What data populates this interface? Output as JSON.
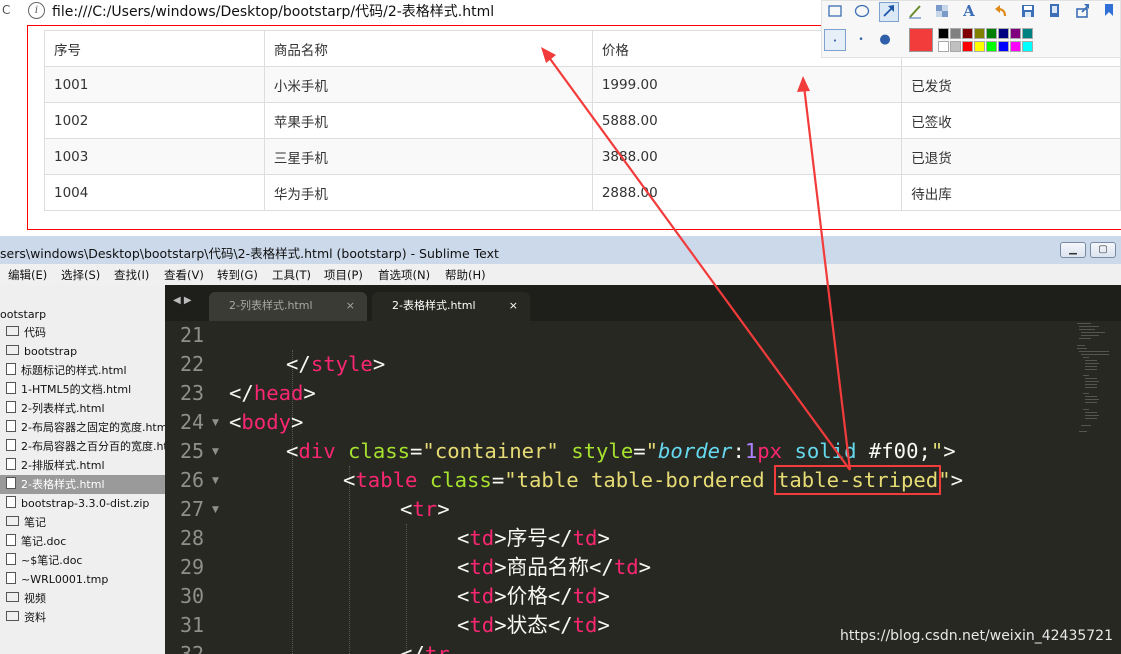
{
  "browser": {
    "url": "file:///C:/Users/windows/Desktop/bootstarp/代码/2-表格样式.html"
  },
  "table": {
    "rows": [
      [
        "序号",
        "商品名称",
        "价格",
        ""
      ],
      [
        "1001",
        "小米手机",
        "1999.00",
        "已发货"
      ],
      [
        "1002",
        "苹果手机",
        "5888.00",
        "已签收"
      ],
      [
        "1003",
        "三星手机",
        "3888.00",
        "已退货"
      ],
      [
        "1004",
        "华为手机",
        "2888.00",
        "待出库"
      ]
    ]
  },
  "annotation_toolbar": {
    "text_tool": "A",
    "current_color": "#f23b3b",
    "palette": [
      "#000000",
      "#808080",
      "#800000",
      "#808000",
      "#008000",
      "#000080",
      "#800080",
      "#008080",
      "#ffffff",
      "#c0c0c0",
      "#ff0000",
      "#ffff00",
      "#00ff00",
      "#0000ff",
      "#ff00ff",
      "#00ffff"
    ],
    "dot_sizes": [
      "•",
      "•",
      "●"
    ]
  },
  "sublime": {
    "title": "sers\\windows\\Desktop\\bootstarp\\代码\\2-表格样式.html (bootstarp) - Sublime Text",
    "menu": [
      "编辑(E)",
      "选择(S)",
      "查找(I)",
      "查看(V)",
      "转到(G)",
      "工具(T)",
      "项目(P)",
      "首选项(N)",
      "帮助(H)"
    ],
    "sidebar": [
      {
        "label": "ootstarp",
        "kind": "root",
        "active": false
      },
      {
        "label": "代码",
        "kind": "folder",
        "active": false
      },
      {
        "label": "bootstrap",
        "kind": "folder",
        "active": false
      },
      {
        "label": "标题标记的样式.html",
        "kind": "file",
        "active": false
      },
      {
        "label": "1-HTML5的文档.html",
        "kind": "file",
        "active": false
      },
      {
        "label": "2-列表样式.html",
        "kind": "file",
        "active": false
      },
      {
        "label": "2-布局容器之固定的宽度.html",
        "kind": "file",
        "active": false
      },
      {
        "label": "2-布局容器之百分百的宽度.html",
        "kind": "file",
        "active": false
      },
      {
        "label": "2-排版样式.html",
        "kind": "file",
        "active": false
      },
      {
        "label": "2-表格样式.html",
        "kind": "file",
        "active": true
      },
      {
        "label": "bootstrap-3.3.0-dist.zip",
        "kind": "file",
        "active": false
      },
      {
        "label": "笔记",
        "kind": "folder",
        "active": false
      },
      {
        "label": "笔记.doc",
        "kind": "file",
        "active": false
      },
      {
        "label": "~$笔记.doc",
        "kind": "file",
        "active": false
      },
      {
        "label": "~WRL0001.tmp",
        "kind": "file",
        "active": false
      },
      {
        "label": "视频",
        "kind": "folder",
        "active": false
      },
      {
        "label": "资料",
        "kind": "folder",
        "active": false
      }
    ],
    "tabs": [
      {
        "label": "2-列表样式.html",
        "active": false
      },
      {
        "label": "2-表格样式.html",
        "active": true
      }
    ],
    "tab_close": "×",
    "nav_arrows": "◀ ▶",
    "line_numbers": [
      "21",
      "22",
      "23",
      "24",
      "25",
      "26",
      "27",
      "28",
      "29",
      "30",
      "31",
      "32"
    ],
    "folded_lines": [
      "24",
      "25",
      "26",
      "27"
    ],
    "code": {
      "l22_close": "</",
      "l22_tag": "style",
      "l22_end": ">",
      "l23_open": "</",
      "l23_tag": "head",
      "l23_end": ">",
      "l24_open": "<",
      "l24_tag": "body",
      "l24_end": ">",
      "l25_open": "<",
      "l25_tag": "div",
      "l25_attr1": "class",
      "l25_eq1": "=",
      "l25_val1": "\"container\"",
      "l25_attr2": "style",
      "l25_eq2": "=",
      "l25_q1": "\"",
      "l25_prop": "border",
      "l25_colon": ":",
      "l25_num": "1",
      "l25_unit": "px",
      "l25_kw": "solid",
      "l25_hex": "#f00",
      "l25_semi": ";",
      "l25_q2": "\"",
      "l25_end": ">",
      "l26_open": "<",
      "l26_tag": "table",
      "l26_attr": "class",
      "l26_eq": "=",
      "l26_val_a": "\"table table-bordered ",
      "l26_val_b": "table-striped",
      "l26_val_c": "\"",
      "l26_end": ">",
      "l27_open": "<",
      "l27_tag": "tr",
      "l27_end": ">",
      "td_tag": "td",
      "l28_text": "序号",
      "l29_text": "商品名称",
      "l30_text": "价格",
      "l31_text": "状态",
      "l32_open": "</",
      "l32_tag": "tr"
    }
  },
  "watermark": "https://blog.csdn.net/weixin_42435721",
  "annotation_color": "#f23b3b"
}
